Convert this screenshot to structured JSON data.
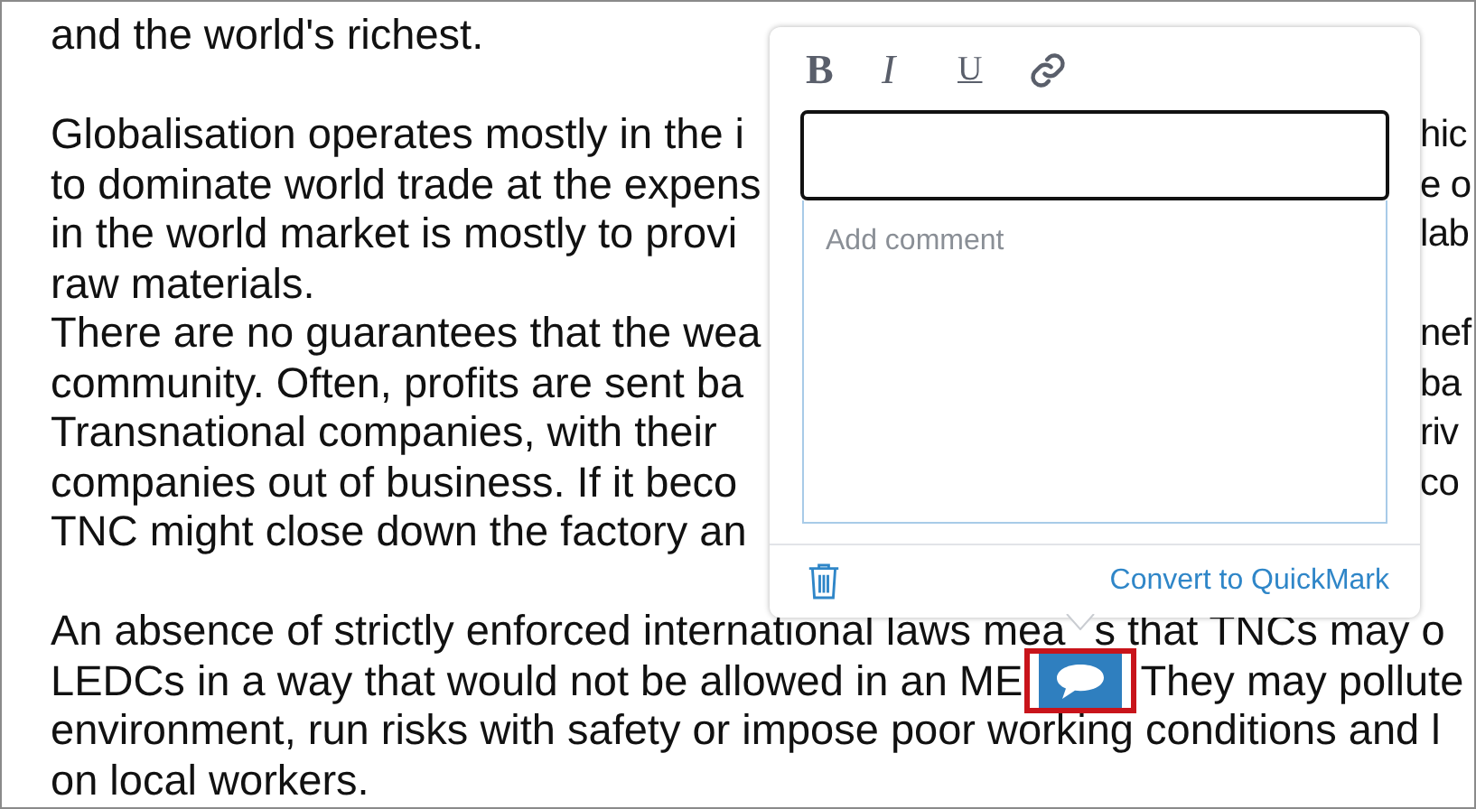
{
  "document": {
    "lines": [
      {
        "kind": "text",
        "left": "and the world's richest."
      },
      {
        "kind": "blank"
      },
      {
        "kind": "split",
        "left": "Globalisation operates mostly in the i",
        "right": "hic"
      },
      {
        "kind": "split",
        "left": "to dominate world trade at the expens",
        "right": "e o"
      },
      {
        "kind": "split",
        "left": "in the world market is mostly to provi",
        "right": "lab"
      },
      {
        "kind": "text",
        "left": "raw materials."
      },
      {
        "kind": "split",
        "left": "There are no guarantees that the wea",
        "right": "nef"
      },
      {
        "kind": "split",
        "left": "community. Often, profits are sent ba",
        "right": "ba"
      },
      {
        "kind": "split",
        "left": "Transnational companies, with their",
        "right": "riv"
      },
      {
        "kind": "split",
        "left": "companies out of business. If it beco",
        "right": "co"
      },
      {
        "kind": "text",
        "left": "TNC might close down the factory an"
      },
      {
        "kind": "blank"
      },
      {
        "kind": "pointer",
        "left": "An absence of strictly enforced international laws mea",
        "right": "s that TNCs may o"
      },
      {
        "kind": "marked",
        "left": "LEDCs in a way that would not be allowed in an ME",
        "right": "They may pollute"
      },
      {
        "kind": "text",
        "left": "environment, run risks with safety or impose poor working conditions and l"
      },
      {
        "kind": "text",
        "left": "on local workers."
      }
    ]
  },
  "comment_marker": {
    "selected": true
  },
  "popup": {
    "toolbar": [
      {
        "kind": "bold",
        "label": "B"
      },
      {
        "kind": "italic",
        "label": "I"
      },
      {
        "kind": "underline",
        "label": "U"
      },
      {
        "kind": "link"
      }
    ],
    "comment_field": {
      "placeholder": "Add comment"
    },
    "convert_link": "Convert to QuickMark"
  }
}
